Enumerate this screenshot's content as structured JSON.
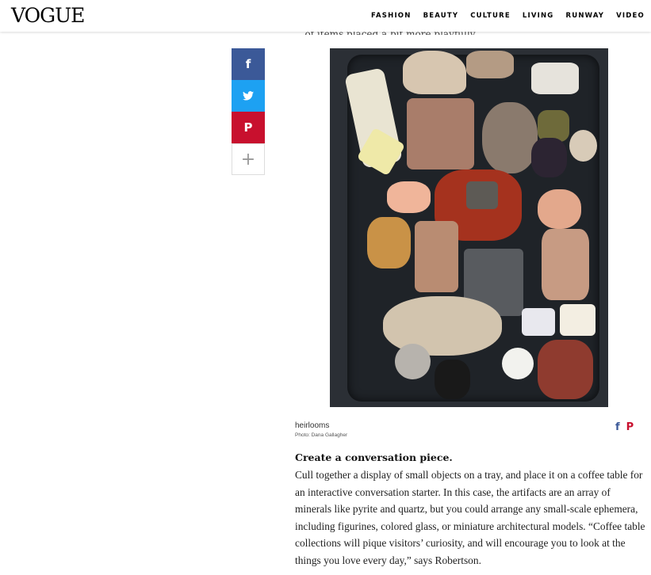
{
  "header": {
    "logo": "VOGUE",
    "nav": [
      "FASHION",
      "BEAUTY",
      "CULTURE",
      "LIVING",
      "RUNWAY",
      "VIDEO"
    ]
  },
  "clipped_text": "...of items placed a bit more playfully",
  "share": {
    "facebook": "f",
    "twitter": "t",
    "pinterest": "P",
    "more": "+"
  },
  "caption": {
    "title": "heirlooms",
    "credit": "Photo: Dana Gallagher"
  },
  "article": {
    "heading": "Create a conversation piece.",
    "body": "Cull together a display of small objects on a tray, and place it on a coffee table for an interactive conversation starter. In this case, the artifacts are an array of minerals like pyrite and quartz, but you could arrange any small-scale ephemera, including figurines, colored glass, or miniature architectural models. “Coffee table collections will pique visitors’ curiosity, and will encourage you to look at the things you love every day,” says Robertson."
  },
  "colors": {
    "facebook": "#3b5998",
    "twitter": "#1da1f2",
    "pinterest": "#c8102e"
  }
}
